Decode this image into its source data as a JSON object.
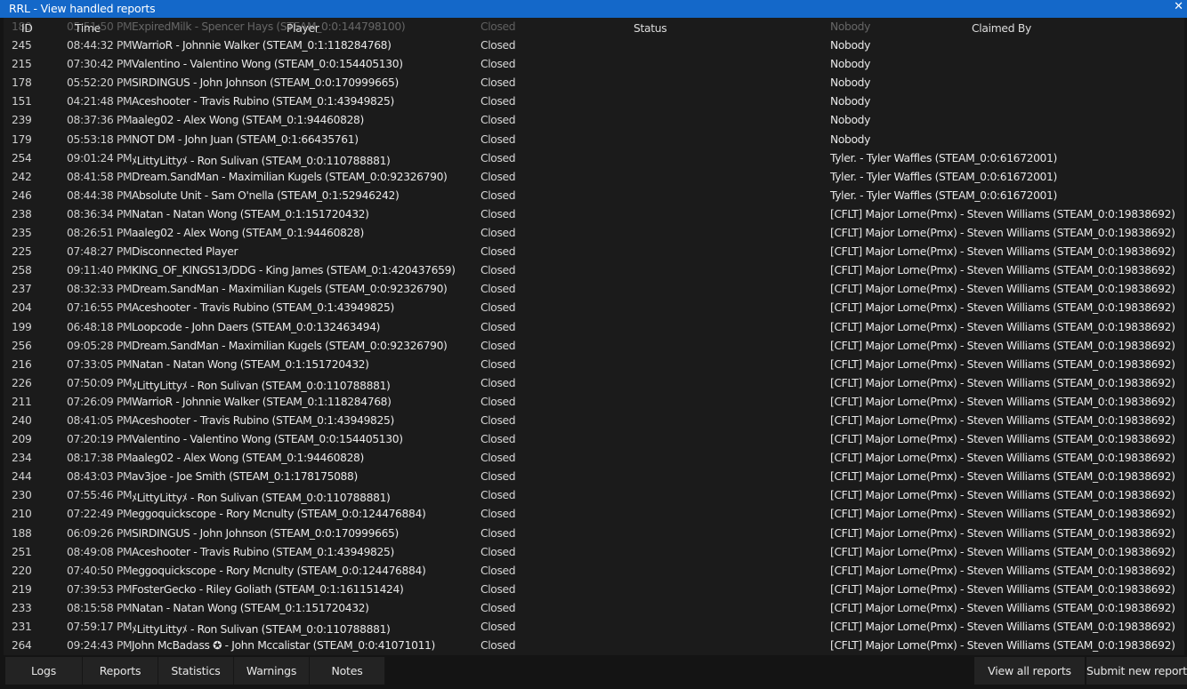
{
  "window": {
    "title": "RRL - View handled reports",
    "close_glyph": "✕"
  },
  "table": {
    "columns": {
      "id": "ID",
      "time": "Time",
      "player": "Player",
      "status": "Status",
      "claimed_by": "Claimed By"
    },
    "rows": [
      {
        "id": "180",
        "time": "05:51:50 PM",
        "player": "ExpiredMilk - Spencer Hays (STEAM_0:0:144798100)",
        "status": "Closed",
        "claimed_by": "Nobody"
      },
      {
        "id": "245",
        "time": "08:44:32 PM",
        "player": "WarrioR - Johnnie Walker (STEAM_0:1:118284768)",
        "status": "Closed",
        "claimed_by": "Nobody"
      },
      {
        "id": "215",
        "time": "07:30:42 PM",
        "player": "Valentino - Valentino Wong (STEAM_0:0:154405130)",
        "status": "Closed",
        "claimed_by": "Nobody"
      },
      {
        "id": "178",
        "time": "05:52:20 PM",
        "player": "SIRDINGUS - John Johnson (STEAM_0:0:170999665)",
        "status": "Closed",
        "claimed_by": "Nobody"
      },
      {
        "id": "151",
        "time": "04:21:48 PM",
        "player": "Aceshooter - Travis Rubino (STEAM_0:1:43949825)",
        "status": "Closed",
        "claimed_by": "Nobody"
      },
      {
        "id": "239",
        "time": "08:37:36 PM",
        "player": "aaleg02 - Alex Wong (STEAM_0:1:94460828)",
        "status": "Closed",
        "claimed_by": "Nobody"
      },
      {
        "id": "179",
        "time": "05:53:18 PM",
        "player": "NOT DM - John Juan (STEAM_0:1:66435761)",
        "status": "Closed",
        "claimed_by": "Nobody"
      },
      {
        "id": "254",
        "time": "09:01:24 PM",
        "player": "ﾒLittyLittyﾒ - Ron Sulivan (STEAM_0:0:110788881)",
        "status": "Closed",
        "claimed_by": "Tyler. - Tyler Waffles (STEAM_0:0:61672001)"
      },
      {
        "id": "242",
        "time": "08:41:58 PM",
        "player": "Dream.SandMan - Maximilian Kugels (STEAM_0:0:92326790)",
        "status": "Closed",
        "claimed_by": "Tyler. - Tyler Waffles (STEAM_0:0:61672001)"
      },
      {
        "id": "246",
        "time": "08:44:38 PM",
        "player": "Absolute Unit - Sam O'nella (STEAM_0:1:52946242)",
        "status": "Closed",
        "claimed_by": "Tyler. - Tyler Waffles (STEAM_0:0:61672001)"
      },
      {
        "id": "238",
        "time": "08:36:34 PM",
        "player": "Natan - Natan Wong (STEAM_0:1:151720432)",
        "status": "Closed",
        "claimed_by": "[CFLT] Major Lorne(Pmx) - Steven Williams (STEAM_0:0:19838692)"
      },
      {
        "id": "235",
        "time": "08:26:51 PM",
        "player": "aaleg02 - Alex Wong (STEAM_0:1:94460828)",
        "status": "Closed",
        "claimed_by": "[CFLT] Major Lorne(Pmx) - Steven Williams (STEAM_0:0:19838692)"
      },
      {
        "id": "225",
        "time": "07:48:27 PM",
        "player": "Disconnected Player",
        "status": "Closed",
        "claimed_by": "[CFLT] Major Lorne(Pmx) - Steven Williams (STEAM_0:0:19838692)"
      },
      {
        "id": "258",
        "time": "09:11:40 PM",
        "player": "KING_OF_KINGS13/DDG - King James (STEAM_0:1:420437659)",
        "status": "Closed",
        "claimed_by": "[CFLT] Major Lorne(Pmx) - Steven Williams (STEAM_0:0:19838692)"
      },
      {
        "id": "237",
        "time": "08:32:33 PM",
        "player": "Dream.SandMan - Maximilian Kugels (STEAM_0:0:92326790)",
        "status": "Closed",
        "claimed_by": "[CFLT] Major Lorne(Pmx) - Steven Williams (STEAM_0:0:19838692)"
      },
      {
        "id": "204",
        "time": "07:16:55 PM",
        "player": "Aceshooter - Travis Rubino (STEAM_0:1:43949825)",
        "status": "Closed",
        "claimed_by": "[CFLT] Major Lorne(Pmx) - Steven Williams (STEAM_0:0:19838692)"
      },
      {
        "id": "199",
        "time": "06:48:18 PM",
        "player": "Loopcode - John Daers (STEAM_0:0:132463494)",
        "status": "Closed",
        "claimed_by": "[CFLT] Major Lorne(Pmx) - Steven Williams (STEAM_0:0:19838692)"
      },
      {
        "id": "256",
        "time": "09:05:28 PM",
        "player": "Dream.SandMan - Maximilian Kugels (STEAM_0:0:92326790)",
        "status": "Closed",
        "claimed_by": "[CFLT] Major Lorne(Pmx) - Steven Williams (STEAM_0:0:19838692)"
      },
      {
        "id": "216",
        "time": "07:33:05 PM",
        "player": "Natan - Natan Wong (STEAM_0:1:151720432)",
        "status": "Closed",
        "claimed_by": "[CFLT] Major Lorne(Pmx) - Steven Williams (STEAM_0:0:19838692)"
      },
      {
        "id": "226",
        "time": "07:50:09 PM",
        "player": "ﾒLittyLittyﾒ - Ron Sulivan (STEAM_0:0:110788881)",
        "status": "Closed",
        "claimed_by": "[CFLT] Major Lorne(Pmx) - Steven Williams (STEAM_0:0:19838692)"
      },
      {
        "id": "211",
        "time": "07:26:09 PM",
        "player": "WarrioR - Johnnie Walker (STEAM_0:1:118284768)",
        "status": "Closed",
        "claimed_by": "[CFLT] Major Lorne(Pmx) - Steven Williams (STEAM_0:0:19838692)"
      },
      {
        "id": "240",
        "time": "08:41:05 PM",
        "player": "Aceshooter - Travis Rubino (STEAM_0:1:43949825)",
        "status": "Closed",
        "claimed_by": "[CFLT] Major Lorne(Pmx) - Steven Williams (STEAM_0:0:19838692)"
      },
      {
        "id": "209",
        "time": "07:20:19 PM",
        "player": "Valentino - Valentino Wong (STEAM_0:0:154405130)",
        "status": "Closed",
        "claimed_by": "[CFLT] Major Lorne(Pmx) - Steven Williams (STEAM_0:0:19838692)"
      },
      {
        "id": "234",
        "time": "08:17:38 PM",
        "player": "aaleg02 - Alex Wong (STEAM_0:1:94460828)",
        "status": "Closed",
        "claimed_by": "[CFLT] Major Lorne(Pmx) - Steven Williams (STEAM_0:0:19838692)"
      },
      {
        "id": "244",
        "time": "08:43:03 PM",
        "player": "av3joe - Joe Smith (STEAM_0:1:178175088)",
        "status": "Closed",
        "claimed_by": "[CFLT] Major Lorne(Pmx) - Steven Williams (STEAM_0:0:19838692)"
      },
      {
        "id": "230",
        "time": "07:55:46 PM",
        "player": "ﾒLittyLittyﾒ - Ron Sulivan (STEAM_0:0:110788881)",
        "status": "Closed",
        "claimed_by": "[CFLT] Major Lorne(Pmx) - Steven Williams (STEAM_0:0:19838692)"
      },
      {
        "id": "210",
        "time": "07:22:49 PM",
        "player": "eggoquickscope - Rory Mcnulty (STEAM_0:0:124476884)",
        "status": "Closed",
        "claimed_by": "[CFLT] Major Lorne(Pmx) - Steven Williams (STEAM_0:0:19838692)"
      },
      {
        "id": "188",
        "time": "06:09:26 PM",
        "player": "SIRDINGUS - John Johnson (STEAM_0:0:170999665)",
        "status": "Closed",
        "claimed_by": "[CFLT] Major Lorne(Pmx) - Steven Williams (STEAM_0:0:19838692)"
      },
      {
        "id": "251",
        "time": "08:49:08 PM",
        "player": "Aceshooter - Travis Rubino (STEAM_0:1:43949825)",
        "status": "Closed",
        "claimed_by": "[CFLT] Major Lorne(Pmx) - Steven Williams (STEAM_0:0:19838692)"
      },
      {
        "id": "220",
        "time": "07:40:50 PM",
        "player": "eggoquickscope - Rory Mcnulty (STEAM_0:0:124476884)",
        "status": "Closed",
        "claimed_by": "[CFLT] Major Lorne(Pmx) - Steven Williams (STEAM_0:0:19838692)"
      },
      {
        "id": "219",
        "time": "07:39:53 PM",
        "player": "FosterGecko - Riley Goliath (STEAM_0:1:161151424)",
        "status": "Closed",
        "claimed_by": "[CFLT] Major Lorne(Pmx) - Steven Williams (STEAM_0:0:19838692)"
      },
      {
        "id": "233",
        "time": "08:15:58 PM",
        "player": "Natan - Natan Wong (STEAM_0:1:151720432)",
        "status": "Closed",
        "claimed_by": "[CFLT] Major Lorne(Pmx) - Steven Williams (STEAM_0:0:19838692)"
      },
      {
        "id": "231",
        "time": "07:59:17 PM",
        "player": "ﾒLittyLittyﾒ - Ron Sulivan (STEAM_0:0:110788881)",
        "status": "Closed",
        "claimed_by": "[CFLT] Major Lorne(Pmx) - Steven Williams (STEAM_0:0:19838692)"
      },
      {
        "id": "264",
        "time": "09:24:43 PM",
        "player": "John McBadass ✪ - John Mccalistar (STEAM_0:0:41071011)",
        "status": "Closed",
        "claimed_by": "[CFLT] Major Lorne(Pmx) - Steven Williams (STEAM_0:0:19838692)"
      }
    ]
  },
  "tabs": [
    "Logs",
    "Reports",
    "Statistics",
    "Warnings",
    "Notes"
  ],
  "actions": {
    "view_all": "View all reports",
    "submit_new": "Submit new report"
  },
  "colors": {
    "title_bar": "#1468c9",
    "background": "#141414",
    "panel": "#1b1b1b",
    "button": "#232323"
  }
}
